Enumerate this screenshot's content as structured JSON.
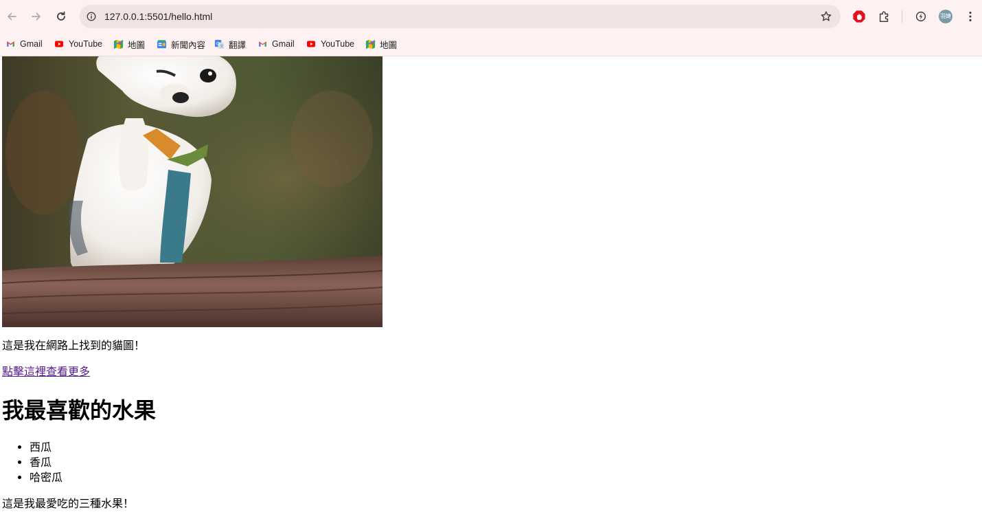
{
  "browser": {
    "url": "127.0.0.1:5501/hello.html",
    "avatar_text": "羽婕",
    "bookmarks": [
      {
        "label": "Gmail",
        "icon": "gmail-icon"
      },
      {
        "label": "YouTube",
        "icon": "youtube-icon"
      },
      {
        "label": "地圖",
        "icon": "maps-icon"
      },
      {
        "label": "新聞內容",
        "icon": "news-icon"
      },
      {
        "label": "翻譯",
        "icon": "translate-icon"
      },
      {
        "label": "Gmail",
        "icon": "gmail-icon"
      },
      {
        "label": "YouTube",
        "icon": "youtube-icon"
      },
      {
        "label": "地圖",
        "icon": "maps-icon"
      }
    ]
  },
  "page": {
    "caption": "這是我在網路上找到的貓圖！",
    "link_text": "點擊這裡查看更多",
    "heading": "我最喜歡的水果",
    "fruits": [
      "西瓜",
      "香瓜",
      "哈密瓜"
    ],
    "footer_text": "這是我最愛吃的三種水果！"
  },
  "colors": {
    "toolbar_bg": "#fdf2f1",
    "omnibox_bg": "#f1e3e3",
    "visited_link": "#551a8b"
  }
}
